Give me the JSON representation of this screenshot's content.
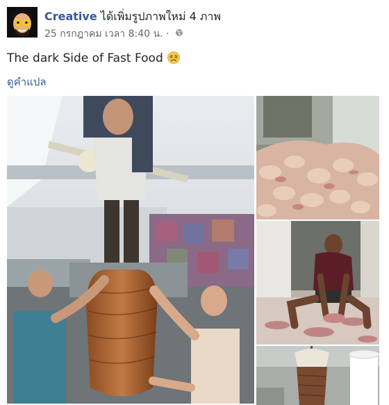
{
  "post": {
    "author": "Creative",
    "action": " ได้เพิ่มรูปภาพใหม่ 4 ภาพ",
    "timestamp": "25 กรกฎาคม เวลา 8:40 น.",
    "separator": " · ",
    "audience_icon": "globe-icon",
    "text": "The dark Side of Fast Food",
    "emoji": "tired-face-emoji",
    "translate_label": "ดูคำแปล"
  },
  "photos": [
    {
      "id": "main",
      "position": "left-large"
    },
    {
      "id": "chicken-pile",
      "position": "right-top"
    },
    {
      "id": "man-on-floor",
      "position": "right-middle"
    },
    {
      "id": "shawarma-rotis",
      "position": "right-bottom"
    }
  ],
  "colors": {
    "link_blue": "#365899",
    "meta_gray": "#616770",
    "text": "#1d2129"
  }
}
